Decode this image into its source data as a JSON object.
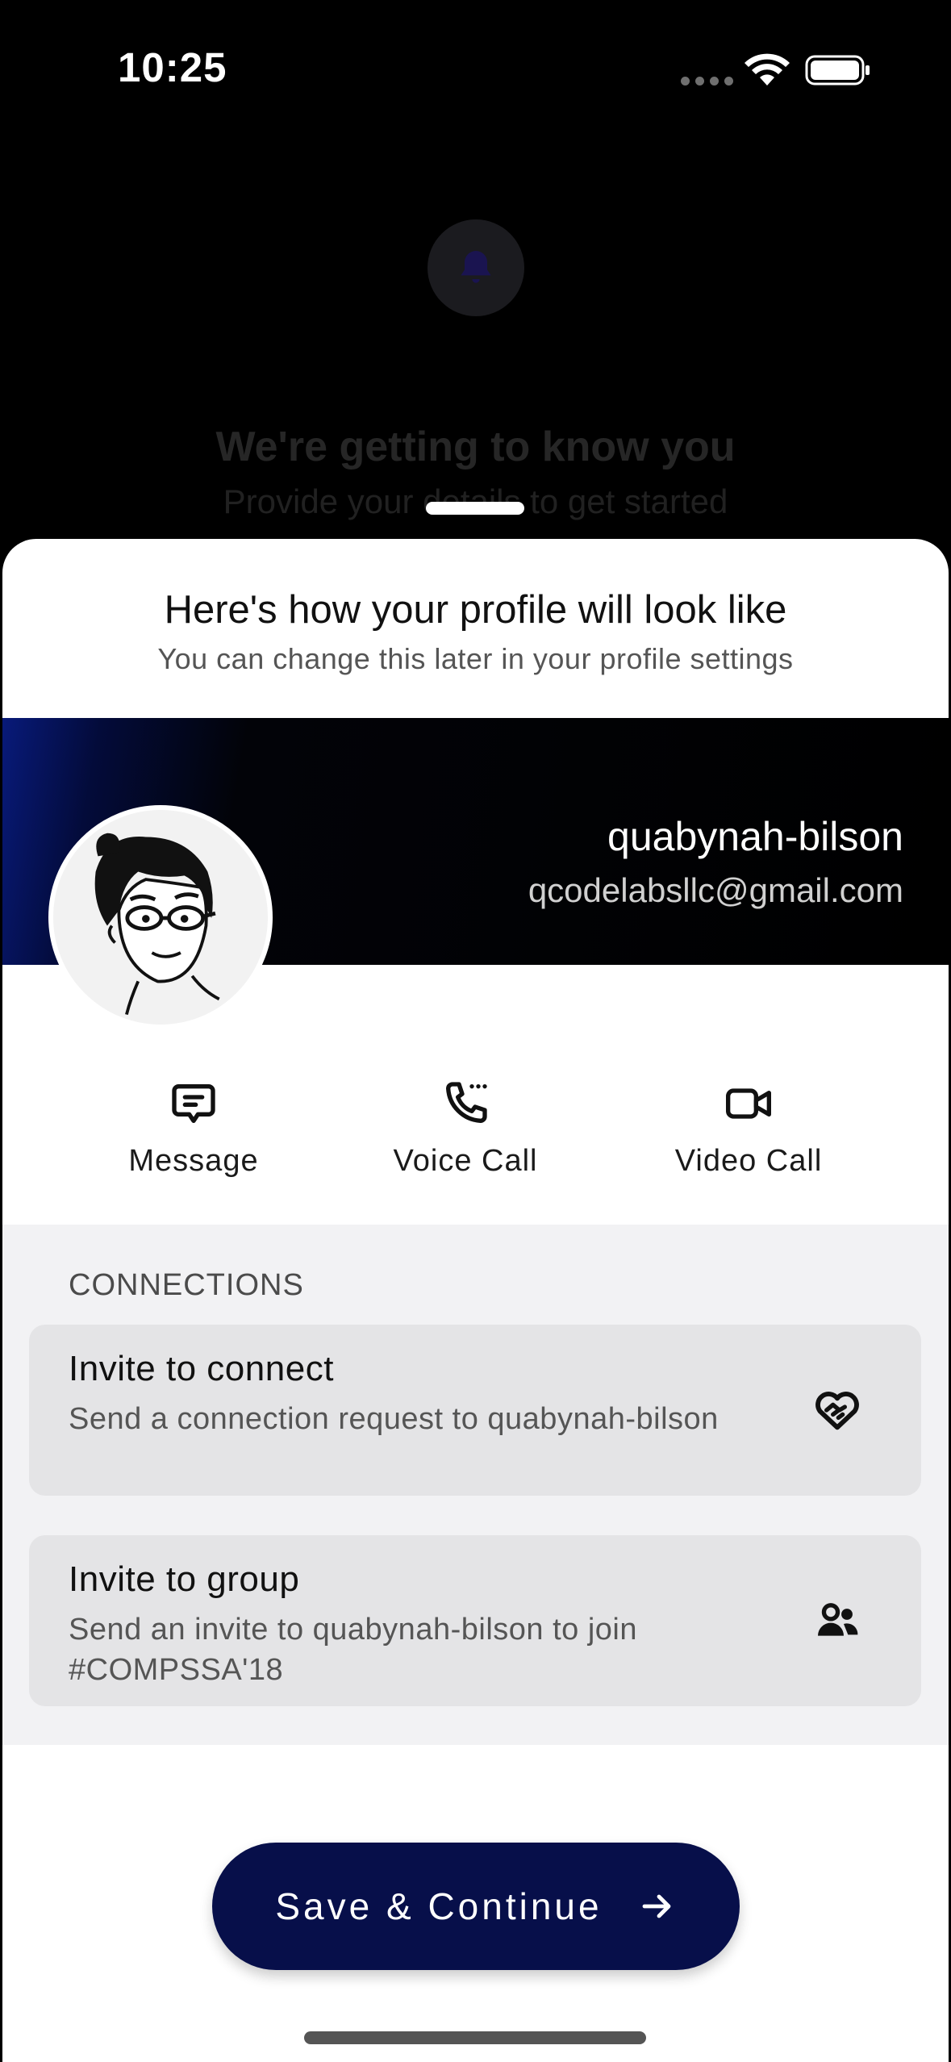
{
  "status_bar": {
    "time": "10:25"
  },
  "background": {
    "title": "We're getting to know you",
    "subtitle": "Provide your details to get started"
  },
  "sheet": {
    "title": "Here's how your profile will look like",
    "subtitle": "You can change this later in your profile settings"
  },
  "profile": {
    "name": "quabynah-bilson",
    "email": "qcodelabsllc@gmail.com"
  },
  "actions": {
    "message": "Message",
    "voice_call": "Voice Call",
    "video_call": "Video Call"
  },
  "connections": {
    "header": "CONNECTIONS",
    "invite_connect": {
      "title": "Invite to connect",
      "description": "Send a connection request to quabynah-bilson"
    },
    "invite_group": {
      "title": "Invite to group",
      "description": "Send an invite to quabynah-bilson to join #COMPSSA'18"
    }
  },
  "cta": {
    "label": "Save & Continue"
  },
  "colors": {
    "primary": "#070f4a",
    "banner_accent": "#081a7a",
    "sheet_bg": "#ffffff",
    "section_bg": "#f2f2f4",
    "card_bg": "#e4e4e6"
  }
}
